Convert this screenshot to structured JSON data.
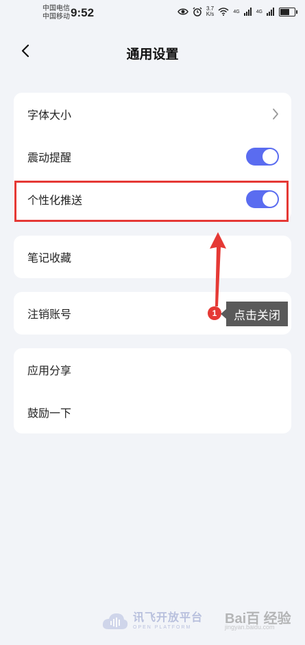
{
  "status_bar": {
    "carrier1": "中国电信",
    "carrier2": "中国移动",
    "time": "9:52",
    "speed_value": "3.7",
    "speed_unit": "K/s",
    "net1": "4G",
    "net2": "4G"
  },
  "nav": {
    "title": "通用设置"
  },
  "card1": {
    "font_size": "字体大小",
    "vibration": "震动提醒",
    "vibration_on": true,
    "push": "个性化推送",
    "push_on": true
  },
  "card2": {
    "notes": "笔记收藏"
  },
  "card3": {
    "cancel_account": "注销账号"
  },
  "card4": {
    "share": "应用分享",
    "encourage": "鼓励一下"
  },
  "annotation": {
    "step": "1",
    "text": "点击关闭",
    "highlight_color": "#e53935"
  },
  "footer": {
    "brand_cn": "讯飞开放平台",
    "brand_en": "OPEN PLATFORM"
  },
  "watermark": {
    "main": "Bai百 经验",
    "sub": "jingyan.baidu.com"
  },
  "colors": {
    "accent": "#5a6cf0",
    "background": "#f2f4f8"
  }
}
